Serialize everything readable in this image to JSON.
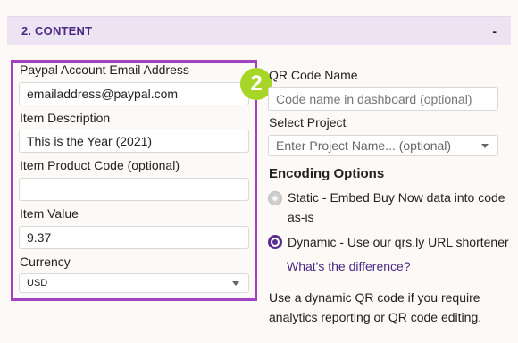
{
  "section": {
    "title": "2. CONTENT",
    "toggle": "-"
  },
  "step_badge": "2",
  "left": {
    "email_label": "Paypal Account Email Address",
    "email_value": "emailaddress@paypal.com",
    "desc_label": "Item Description",
    "desc_value": "This is the Year (2021)",
    "code_label": "Item Product Code (optional)",
    "code_value": "",
    "value_label": "Item Value",
    "value_value": "9.37",
    "currency_label": "Currency",
    "currency_value": "USD"
  },
  "right": {
    "qr_name_label": "QR Code Name",
    "qr_name_placeholder": "Code name in dashboard (optional)",
    "project_label": "Select Project",
    "project_placeholder": "Enter Project Name... (optional)",
    "encoding_heading": "Encoding Options",
    "static_line1": "Static - Embed Buy Now data into code",
    "static_line2": "as-is",
    "dynamic_label": "Dynamic - Use our qrs.ly URL shortener",
    "difference_link": "What's the difference?",
    "help_line1": "Use a dynamic QR code if you require",
    "help_line2": "analytics reporting or QR code editing."
  }
}
